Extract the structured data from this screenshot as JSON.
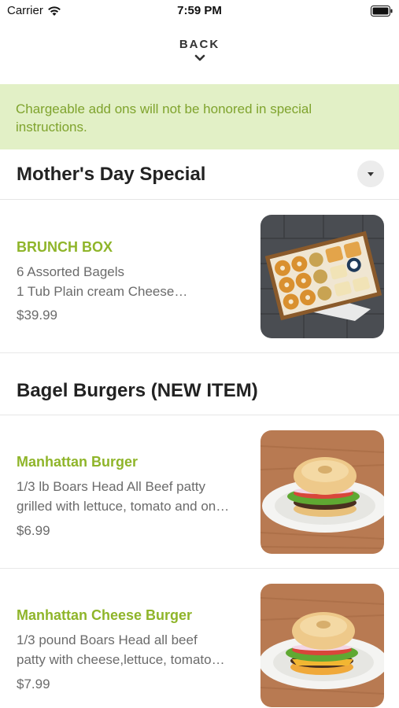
{
  "status_bar": {
    "carrier": "Carrier",
    "time": "7:59 PM"
  },
  "nav": {
    "back_label": "BACK"
  },
  "notice": {
    "text": "Chargeable add ons will not be honored in special instructions."
  },
  "sections": [
    {
      "title": "Mother's Day Special",
      "items": [
        {
          "name": "BRUNCH BOX",
          "desc_line1": "6 Assorted Bagels",
          "desc_line2": "1 Tub Plain cream Cheese…",
          "price": "$39.99"
        }
      ]
    },
    {
      "title": "Bagel Burgers (NEW ITEM)",
      "items": [
        {
          "name": "Manhattan Burger",
          "desc_line1": "1/3 lb Boars Head All Beef patty",
          "desc_line2": "grilled with lettuce, tomato and on…",
          "price": "$6.99"
        },
        {
          "name": "Manhattan Cheese Burger",
          "desc_line1": "1/3 pound Boars Head all beef",
          "desc_line2": "patty with cheese,lettuce, tomato…",
          "price": "$7.99"
        }
      ]
    }
  ],
  "colors": {
    "accent_green": "#8fb52a",
    "notice_bg": "#e2f0c6",
    "notice_text": "#7fa32d"
  },
  "icons": {
    "wifi": "wifi-icon",
    "battery": "battery-icon",
    "back": "chevron-down-icon",
    "collapse": "caret-down-icon"
  }
}
